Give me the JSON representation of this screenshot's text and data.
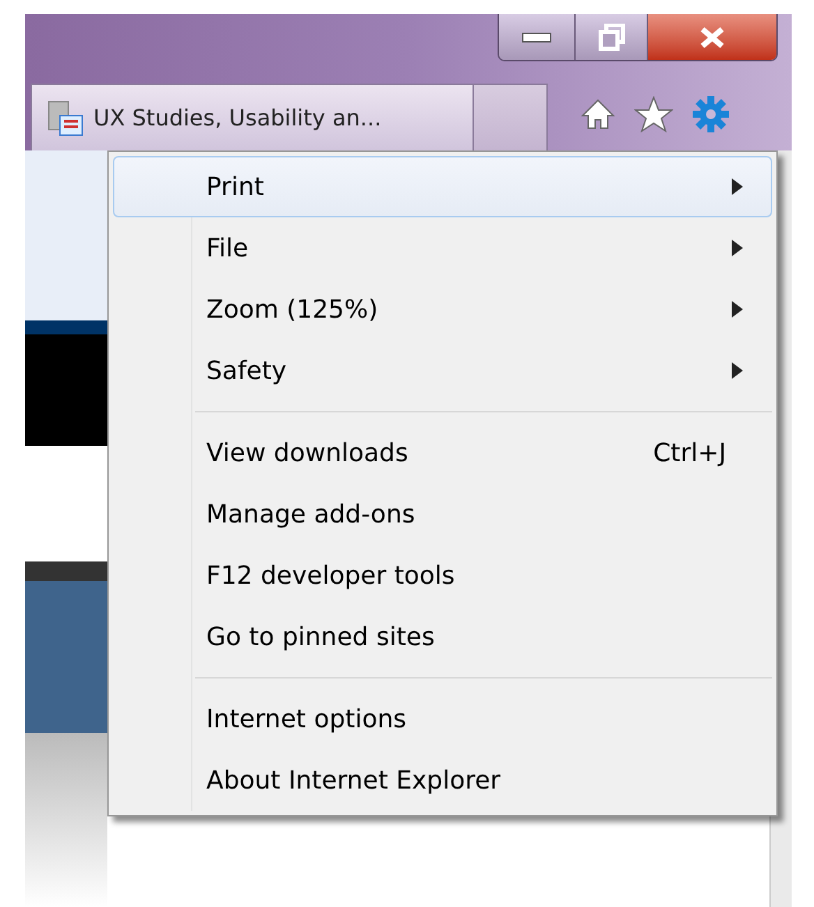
{
  "tab": {
    "title": "UX Studies, Usability an..."
  },
  "menu": {
    "groups": [
      [
        {
          "label": "Print",
          "submenu": true,
          "selected": true
        },
        {
          "label": "File",
          "submenu": true,
          "selected": false
        },
        {
          "label": "Zoom (125%)",
          "submenu": true,
          "selected": false
        },
        {
          "label": "Safety",
          "submenu": true,
          "selected": false
        }
      ],
      [
        {
          "label": "View downloads",
          "shortcut": "Ctrl+J",
          "submenu": false,
          "selected": false
        },
        {
          "label": "Manage add-ons",
          "submenu": false,
          "selected": false
        },
        {
          "label": "F12 developer tools",
          "submenu": false,
          "selected": false
        },
        {
          "label": "Go to pinned sites",
          "submenu": false,
          "selected": false
        }
      ],
      [
        {
          "label": "Internet options",
          "submenu": false,
          "selected": false
        },
        {
          "label": "About Internet Explorer",
          "submenu": false,
          "selected": false
        }
      ]
    ]
  }
}
